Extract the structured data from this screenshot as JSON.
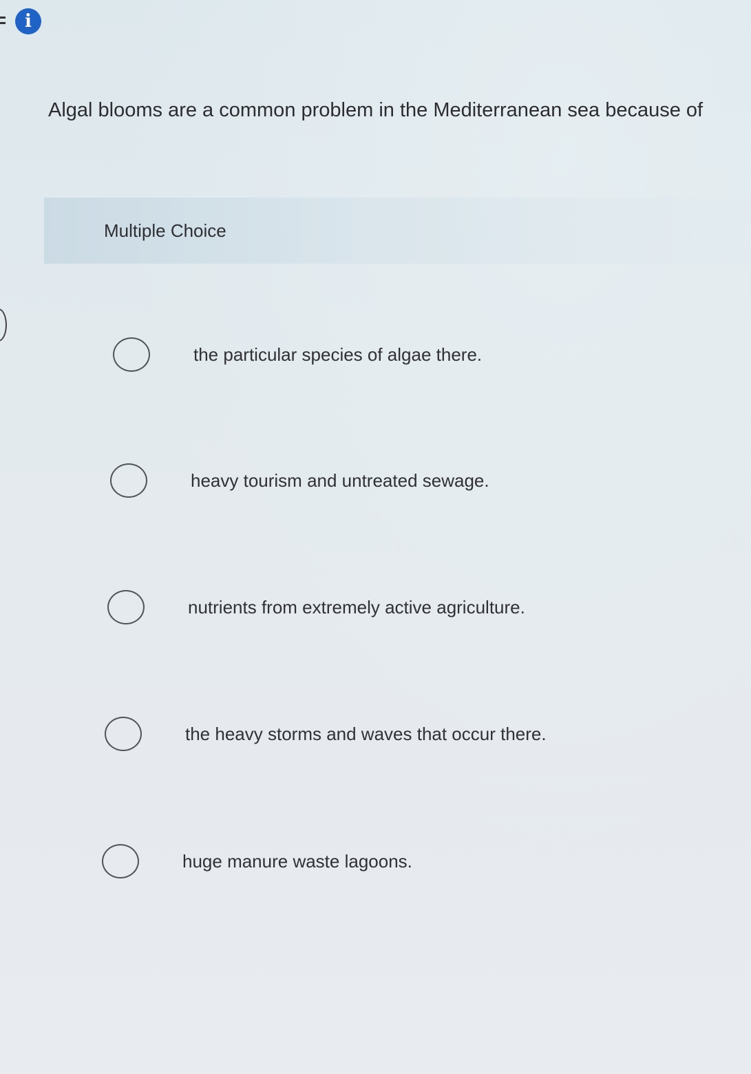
{
  "header": {
    "info_icon": "info-icon",
    "info_glyph": "i"
  },
  "question": {
    "text": "Algal blooms are a common problem in the Mediterranean sea because of"
  },
  "question_type": {
    "label": "Multiple Choice"
  },
  "options": [
    {
      "label": "the particular species of algae there."
    },
    {
      "label": "heavy tourism and untreated sewage."
    },
    {
      "label": "nutrients from extremely active agriculture."
    },
    {
      "label": "the heavy storms and waves that occur there."
    },
    {
      "label": "huge manure waste lagoons."
    }
  ],
  "colors": {
    "accent": "#1f63c6",
    "text": "#2b2d31",
    "radio_border": "#4f545b"
  }
}
